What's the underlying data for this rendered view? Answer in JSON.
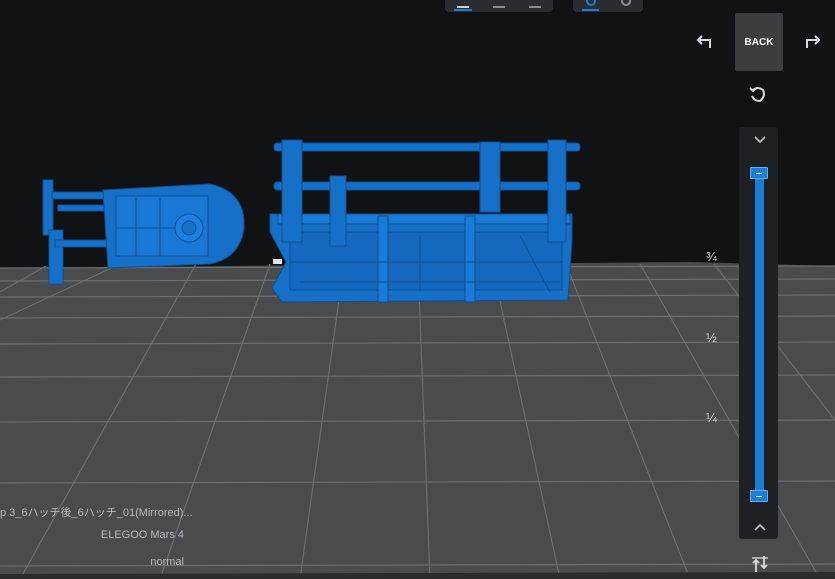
{
  "back_button": {
    "label": "BACK"
  },
  "slider": {
    "marks": [
      "¾",
      "½",
      "¼"
    ],
    "upper_level": 1.0,
    "lower_level": 0.0
  },
  "model_info": {
    "file_name": "p 3_6ハッチ後_6ハッチ_01(Mirrored)...",
    "printer": "ELEGOO Mars 4",
    "mode": "normal"
  },
  "colors": {
    "accent": "#1a7fd4",
    "model": "#1670c8",
    "background": "#111214",
    "plate": "#4a4b4d"
  },
  "icons": [
    "undo-icon",
    "redo-icon",
    "rotate-icon",
    "chevron-down-icon",
    "chevron-up-icon",
    "layer-adjust-icon"
  ]
}
